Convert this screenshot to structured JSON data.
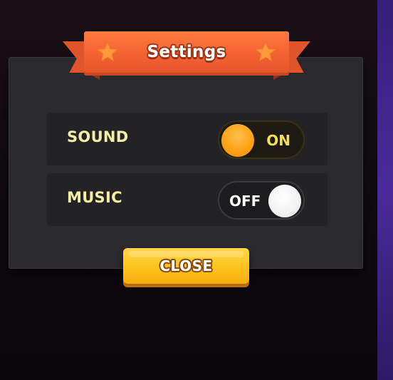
{
  "dialog": {
    "title": "Settings",
    "title_icons": [
      "star-icon",
      "star-icon"
    ]
  },
  "settings": [
    {
      "label": "SOUND",
      "state": "ON",
      "enabled": true
    },
    {
      "label": "MUSIC",
      "state": "OFF",
      "enabled": false
    }
  ],
  "close_button": {
    "label": "CLOSE"
  },
  "colors": {
    "ribbon": "#f26131",
    "star": "#ff9a3c",
    "label_text": "#f3eea2",
    "toggle_on_knob": "#ffa315",
    "toggle_on_text": "#f6dd58",
    "toggle_off_knob": "#f2f2f2",
    "button": "#ffc51e",
    "panel": "#2a2a2e"
  }
}
